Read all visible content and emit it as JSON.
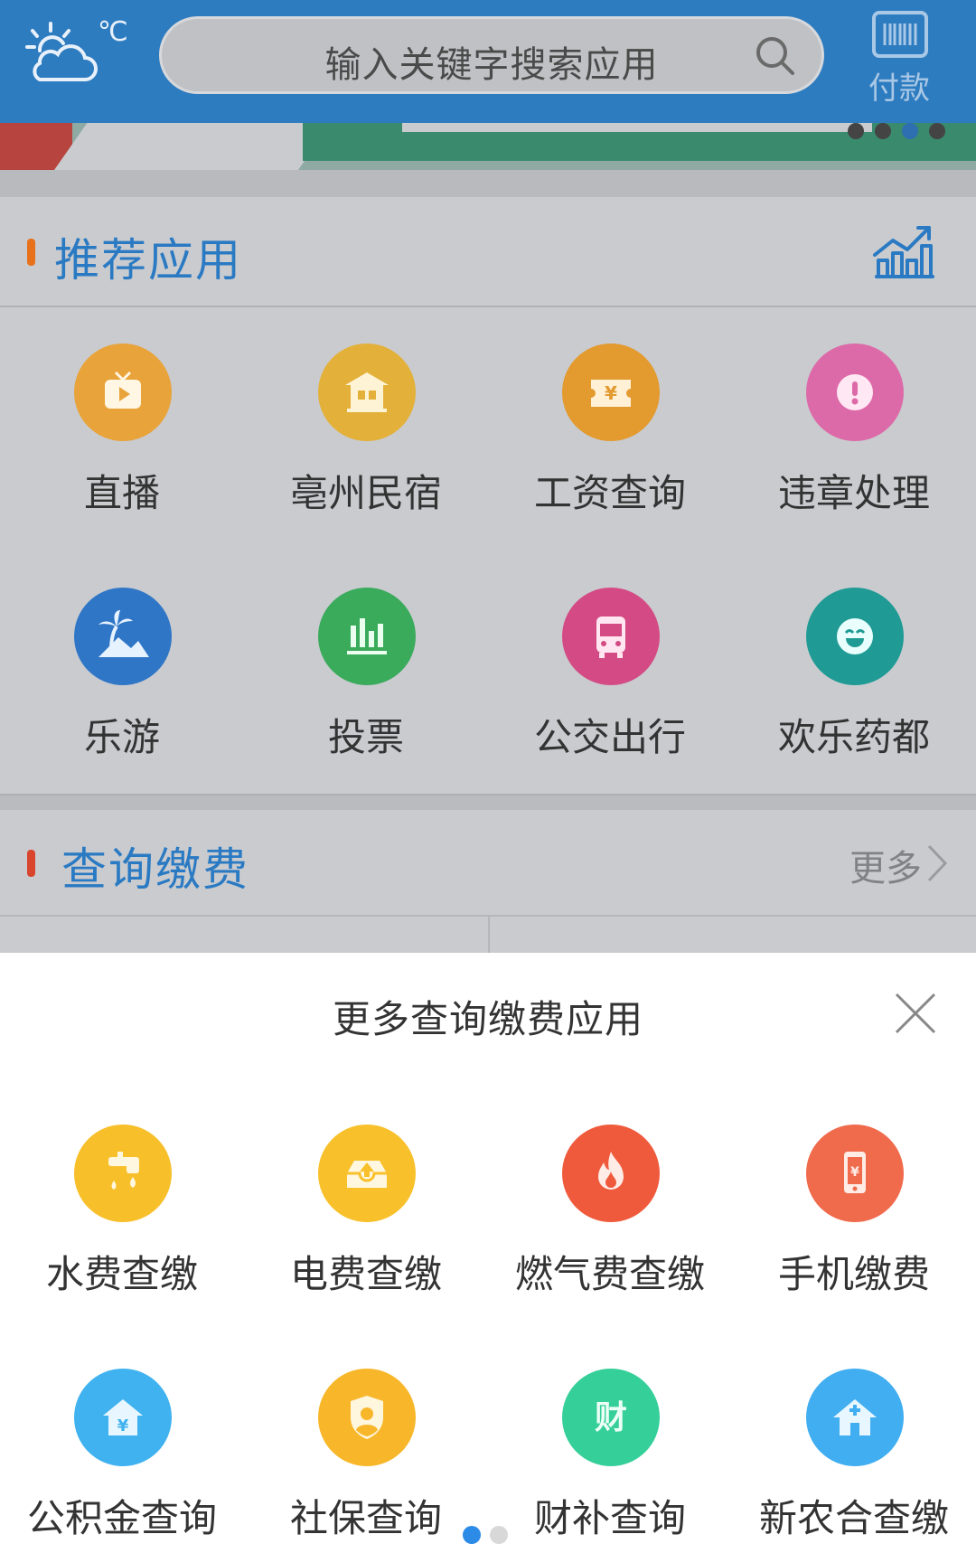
{
  "header": {
    "weather_icon": "cloud-sun-icon",
    "temperature_unit": "℃",
    "search_placeholder": "输入关键字搜索应用",
    "pay_label": "付款"
  },
  "recommended": {
    "title": "推荐应用",
    "bar_color": "#e8711b",
    "apps": [
      {
        "label": "直播",
        "icon": "tv-play-icon",
        "color": "#e8a33a"
      },
      {
        "label": "亳州民宿",
        "icon": "house-icon",
        "color": "#e3b13a"
      },
      {
        "label": "工资查询",
        "icon": "ticket-yen-icon",
        "color": "#e39a2e"
      },
      {
        "label": "违章处理",
        "icon": "warning-icon",
        "color": "#dd6aa8"
      },
      {
        "label": "乐游",
        "icon": "palm-tree-icon",
        "color": "#2f76c6"
      },
      {
        "label": "投票",
        "icon": "bar-chart-icon",
        "color": "#3aaa5b"
      },
      {
        "label": "公交出行",
        "icon": "bus-icon",
        "color": "#d44a84"
      },
      {
        "label": "欢乐药都",
        "icon": "smile-icon",
        "color": "#1f9a94"
      }
    ]
  },
  "payment": {
    "title": "查询缴费",
    "bar_color": "#d9442d",
    "more_label": "更多"
  },
  "sheet": {
    "title": "更多查询缴费应用",
    "apps": [
      {
        "label": "水费查缴",
        "icon": "faucet-icon",
        "color": "#f7bf2a"
      },
      {
        "label": "电费查缴",
        "icon": "upload-tray-icon",
        "color": "#f8c12b"
      },
      {
        "label": "燃气费查缴",
        "icon": "flame-icon",
        "color": "#f05a3c"
      },
      {
        "label": "手机缴费",
        "icon": "phone-yen-icon",
        "color": "#f06a4c"
      },
      {
        "label": "公积金查询",
        "icon": "house-yen-icon",
        "color": "#3fb2ef"
      },
      {
        "label": "社保查询",
        "icon": "shield-person-icon",
        "color": "#f8b72a"
      },
      {
        "label": "财补查询",
        "icon": "cai-icon",
        "color": "#35cf9a"
      },
      {
        "label": "新农合查缴",
        "icon": "house-plus-icon",
        "color": "#40aef0"
      }
    ]
  }
}
